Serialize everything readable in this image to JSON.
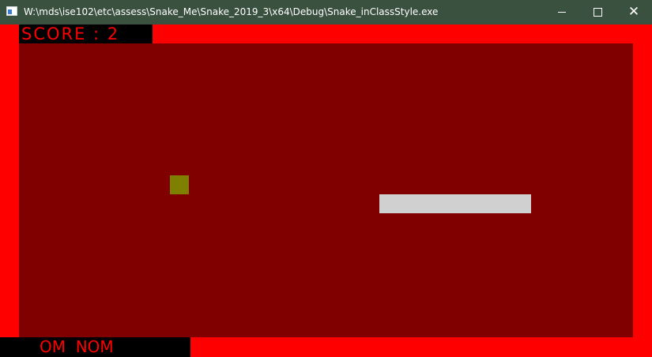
{
  "window": {
    "title": "W:\\mds\\ise102\\etc\\assess\\Snake_Me\\Snake_2019_3\\x64\\Debug\\Snake_inClassStyle.exe",
    "icon": "console-app-icon",
    "controls": {
      "minimize_icon": "minimize-icon",
      "maximize_icon": "maximize-icon",
      "close_icon": "close-icon",
      "close_glyph": "✕"
    }
  },
  "game": {
    "score_text": "SCORE : 2",
    "footer_text": "OM  NOM",
    "colors": {
      "border": "#ff0000",
      "playfield": "#800000",
      "snake": "#d0d0d0",
      "food": "#808000",
      "text": "#ff0000",
      "titlebar": "#3a5140"
    },
    "grid": {
      "columns": 32,
      "rows": 15
    },
    "snake": {
      "cells": [
        {
          "col": 19,
          "row": 8
        },
        {
          "col": 20,
          "row": 8
        },
        {
          "col": 21,
          "row": 8
        },
        {
          "col": 22,
          "row": 8
        },
        {
          "col": 23,
          "row": 8
        },
        {
          "col": 24,
          "row": 8
        },
        {
          "col": 25,
          "row": 8
        },
        {
          "col": 26,
          "row": 8
        }
      ]
    },
    "food": {
      "col": 8,
      "row": 7
    }
  }
}
